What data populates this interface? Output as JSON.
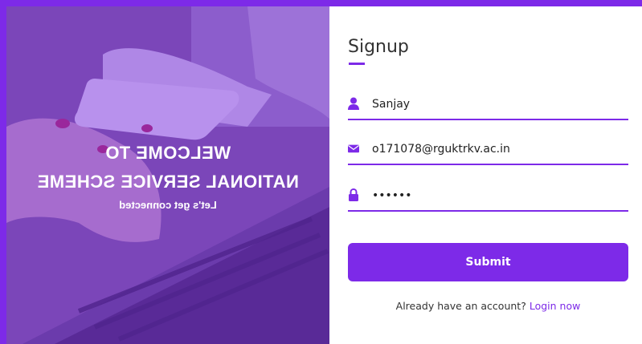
{
  "colors": {
    "accent": "#7d2ae8",
    "text": "#333333",
    "background": "#ffffff"
  },
  "left_panel": {
    "welcome_line1": "WELCOME TO",
    "welcome_line2": "NATIONAL SERVICE SCHEME",
    "tagline": "Let's get connected"
  },
  "form": {
    "title": "Signup",
    "name_field": {
      "value": "Sanjay",
      "icon": "user-icon"
    },
    "email_field": {
      "value": "o171078@rguktrkv.ac.in",
      "icon": "envelope-icon"
    },
    "password_field": {
      "value": "••••••",
      "icon": "lock-icon"
    },
    "submit_label": "Submit",
    "login_prompt": "Already have an account?",
    "login_link": "Login now"
  }
}
